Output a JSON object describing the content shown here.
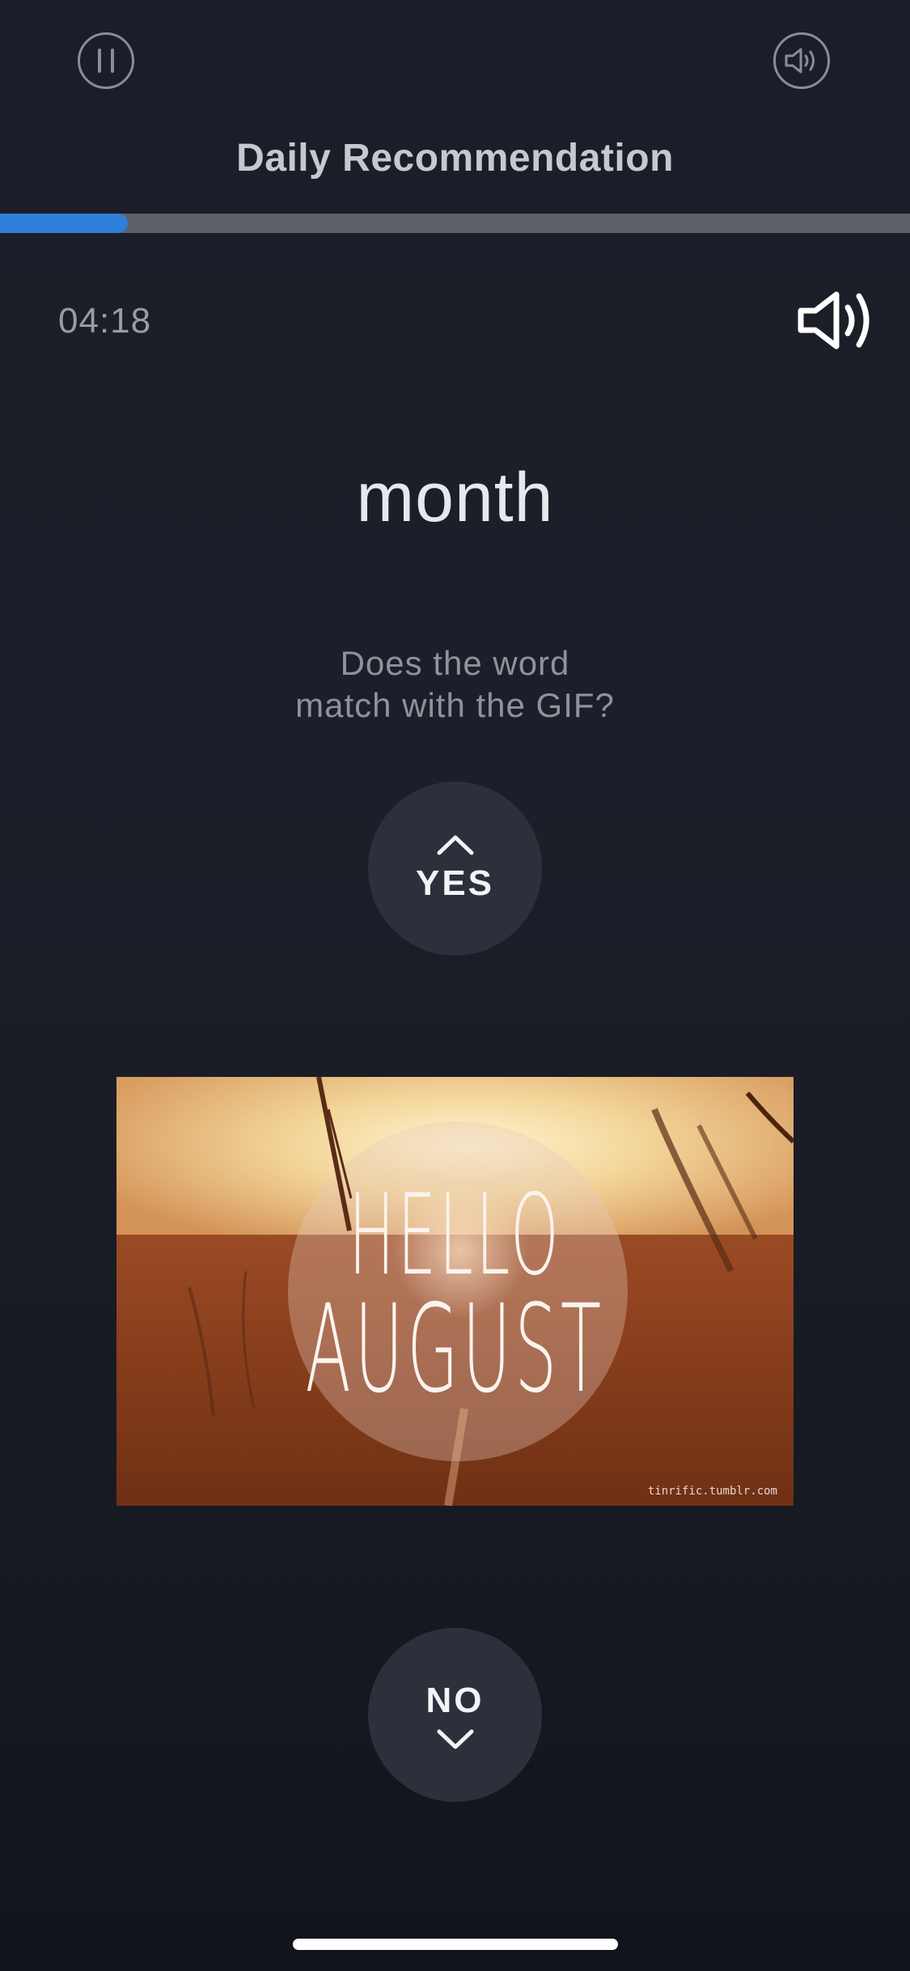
{
  "header": {
    "title": "Daily Recommendation",
    "progress_fraction": 0.14,
    "pause_icon": "pause-icon",
    "sound_icon": "speaker-icon"
  },
  "quiz": {
    "timer": "04:18",
    "word": "month",
    "question_line1": "Does the word",
    "question_line2": "match with the GIF?",
    "yes_label": "YES",
    "no_label": "NO"
  },
  "gif": {
    "text_line1": "HELLO",
    "text_line2": "AUGUST",
    "credit": "tinrific.tumblr.com"
  },
  "colors": {
    "background": "#1b1e28",
    "accent": "#2f7fdb",
    "button_bg": "#2d303b"
  }
}
